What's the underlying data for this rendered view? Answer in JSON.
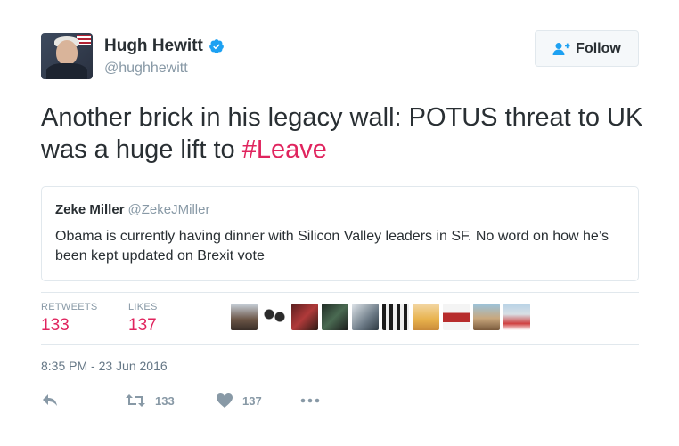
{
  "author": {
    "name": "Hugh Hewitt",
    "handle": "@hughhewitt"
  },
  "follow_label": "Follow",
  "tweet": {
    "text": "Another brick in his legacy wall: POTUS threat to UK was a huge lift to ",
    "hashtag": "#Leave"
  },
  "quoted": {
    "name": "Zeke Miller",
    "handle": "@ZekeJMiller",
    "text": "Obama is currently having dinner with Silicon Valley leaders in SF. No word on how he’s been kept updated on Brexit vote"
  },
  "stats": {
    "retweets_label": "RETWEETS",
    "retweets": "133",
    "likes_label": "LIKES",
    "likes": "137"
  },
  "timestamp": "8:35 PM - 23 Jun 2016",
  "actions": {
    "retweet_count": "133",
    "like_count": "137"
  },
  "colors": {
    "accent": "#e0245e",
    "verified": "#1da1f2",
    "follow_icon": "#1da1f2"
  }
}
